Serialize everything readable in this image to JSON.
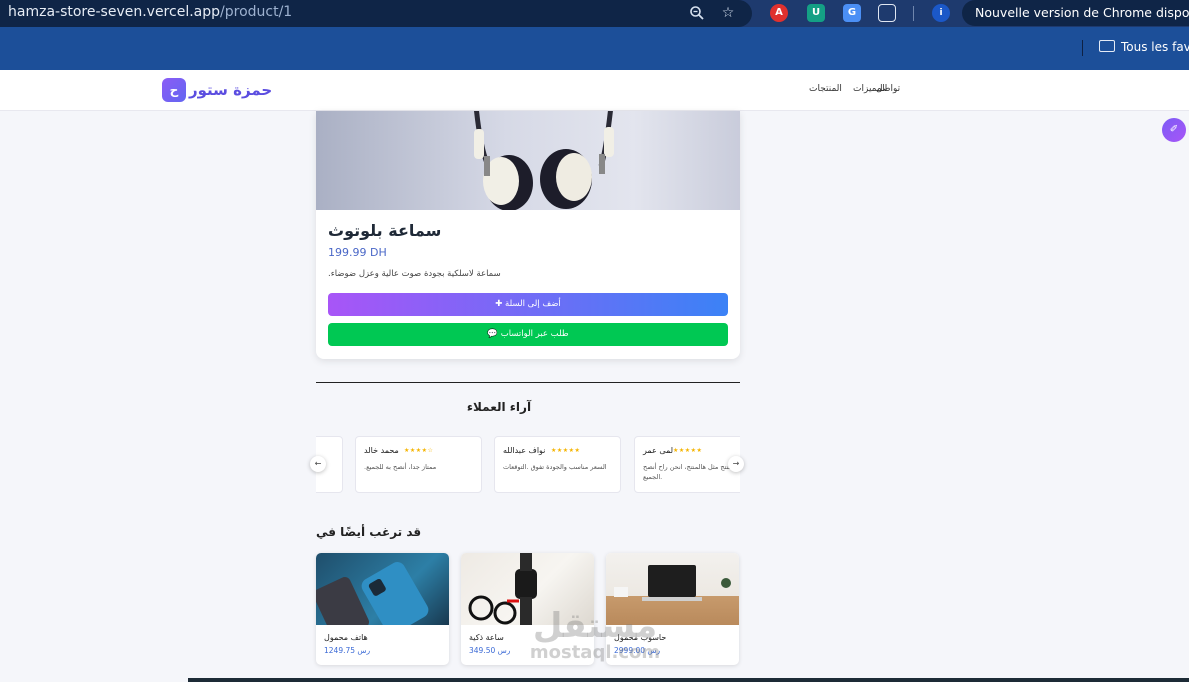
{
  "browser": {
    "url_host": "hamza-store-seven.vercel.app",
    "url_path": "/product/1",
    "update_notice": "Nouvelle version de Chrome disponible",
    "bookmark_folder": "Tous les favo",
    "extensions": [
      "zoom-icon",
      "star-icon",
      "adblock-icon",
      "shield-ext-icon",
      "translate-icon",
      "puzzle-icon",
      "profile-icon"
    ]
  },
  "site": {
    "logo_badge": "ح",
    "logo_text": "حمزة ستور",
    "nav": {
      "contact": "تواصل",
      "features": "المميزات",
      "products": "المنتجات"
    },
    "float_icon": "✐"
  },
  "product": {
    "title": "سماعة بلوتوث",
    "price": "199.99 DH",
    "description": ".سماعة لاسلكية بجودة صوت عالية وعزل ضوضاء",
    "add_to_cart": "أضف إلى السلة",
    "whatsapp_order": "طلب عبر الواتساب"
  },
  "reviews": {
    "title": "آراء العملاء",
    "items": [
      {
        "name": "محمد خالد",
        "stars": "★★★★☆",
        "text": ".ممتاز جدا، أنصح به للجميع"
      },
      {
        "name": "نواف عبدالله",
        "stars": "★★★★★",
        "text": "السعر مناسب والجودة تفوق .التوقعات"
      },
      {
        "name": "لمى عمر",
        "stars": "★★★★★",
        "text": "منتج مثل هالمنتج، انحن راح أنصح .الجميع"
      }
    ],
    "prev_arrow": "←",
    "next_arrow": "→"
  },
  "related": {
    "title": "قد ترغب أيضًا في",
    "items": [
      {
        "name": "هاتف محمول",
        "price": "1249.75 رس"
      },
      {
        "name": "ساعة ذكية",
        "price": "349.50 رس"
      },
      {
        "name": "حاسوب محمول",
        "price": "2999.00 رس"
      }
    ]
  },
  "watermark": {
    "arabic": "مستقل",
    "latin": "mostaql.com"
  }
}
